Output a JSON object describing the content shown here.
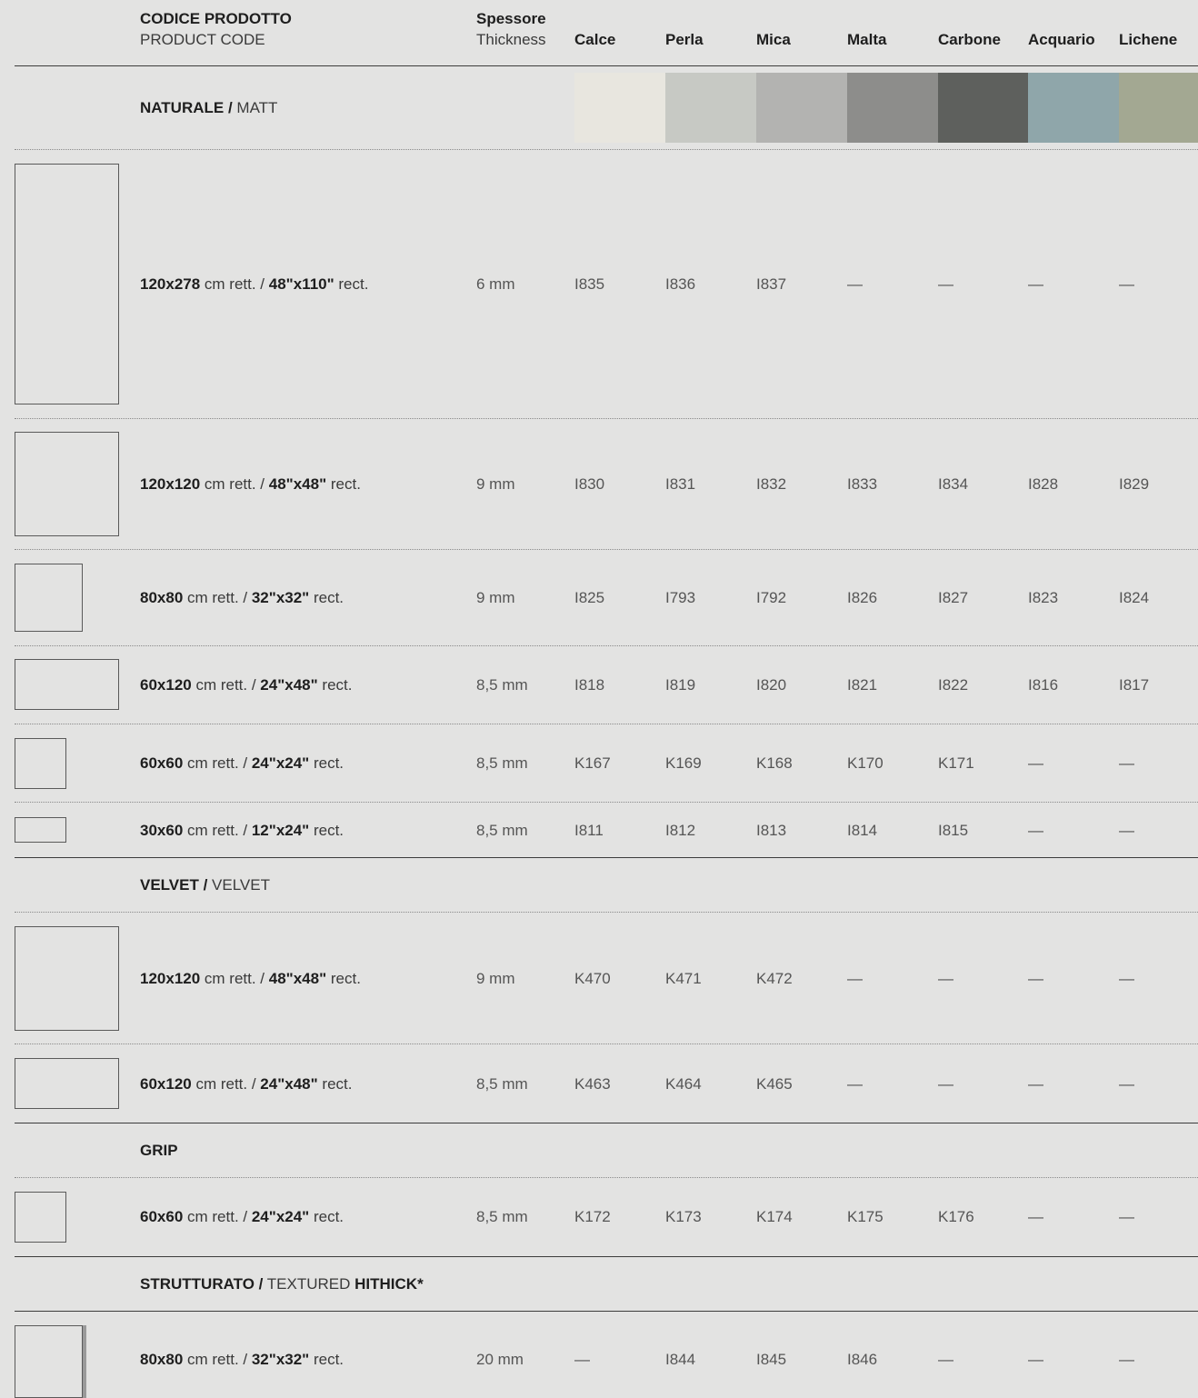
{
  "header": {
    "code_bold": "CODICE PRODOTTO",
    "code_sub": "PRODUCT CODE",
    "thick_bold": "Spessore",
    "thick_sub": "Thickness",
    "colors": [
      "Calce",
      "Perla",
      "Mica",
      "Malta",
      "Carbone",
      "Acquario",
      "Lichene"
    ]
  },
  "swatch_colors": [
    "#e8e6df",
    "#c7c9c4",
    "#b3b3b1",
    "#8d8d8b",
    "#5e605d",
    "#8fa6aa",
    "#a3a892"
  ],
  "sections": {
    "naturale": {
      "bold": "NATURALE /",
      "rest": " MATT"
    },
    "velvet": {
      "bold": "VELVET /",
      "rest": " VELVET"
    },
    "grip": {
      "bold": "GRIP",
      "rest": ""
    },
    "strutturato": {
      "bold": "STRUTTURATO /",
      "rest": " TEXTURED ",
      "bold2": "HITHICK*"
    }
  },
  "rows": [
    {
      "cm": "120x278",
      "cm_suffix": " cm rett. / ",
      "in": "48\"x110\"",
      "in_suffix": " rect.",
      "thickness": "6 mm",
      "codes": [
        "I835",
        "I836",
        "I837",
        "—",
        "—",
        "—",
        "—"
      ]
    },
    {
      "cm": "120x120",
      "cm_suffix": " cm rett. / ",
      "in": "48\"x48\"",
      "in_suffix": " rect.",
      "thickness": "9 mm",
      "codes": [
        "I830",
        "I831",
        "I832",
        "I833",
        "I834",
        "I828",
        "I829"
      ]
    },
    {
      "cm": "80x80",
      "cm_suffix": " cm rett. / ",
      "in": "32\"x32\"",
      "in_suffix": " rect.",
      "thickness": "9 mm",
      "codes": [
        "I825",
        "I793",
        "I792",
        "I826",
        "I827",
        "I823",
        "I824"
      ]
    },
    {
      "cm": "60x120",
      "cm_suffix": " cm rett. / ",
      "in": "24\"x48\"",
      "in_suffix": " rect.",
      "thickness": "8,5 mm",
      "codes": [
        "I818",
        "I819",
        "I820",
        "I821",
        "I822",
        "I816",
        "I817"
      ]
    },
    {
      "cm": "60x60",
      "cm_suffix": " cm rett. / ",
      "in": "24\"x24\"",
      "in_suffix": " rect.",
      "thickness": "8,5 mm",
      "codes": [
        "K167",
        "K169",
        "K168",
        "K170",
        "K171",
        "—",
        "—"
      ]
    },
    {
      "cm": "30x60",
      "cm_suffix": " cm rett. / ",
      "in": "12\"x24\"",
      "in_suffix": " rect.",
      "thickness": "8,5 mm",
      "codes": [
        "I811",
        "I812",
        "I813",
        "I814",
        "I815",
        "—",
        "—"
      ]
    },
    {
      "cm": "120x120",
      "cm_suffix": " cm rett. / ",
      "in": "48\"x48\"",
      "in_suffix": " rect.",
      "thickness": "9 mm",
      "codes": [
        "K470",
        "K471",
        "K472",
        "—",
        "—",
        "—",
        "—"
      ]
    },
    {
      "cm": "60x120",
      "cm_suffix": " cm rett. / ",
      "in": "24\"x48\"",
      "in_suffix": " rect.",
      "thickness": "8,5 mm",
      "codes": [
        "K463",
        "K464",
        "K465",
        "—",
        "—",
        "—",
        "—"
      ]
    },
    {
      "cm": "60x60",
      "cm_suffix": " cm rett. / ",
      "in": "24\"x24\"",
      "in_suffix": " rect.",
      "thickness": "8,5 mm",
      "codes": [
        "K172",
        "K173",
        "K174",
        "K175",
        "K176",
        "—",
        "—"
      ]
    },
    {
      "cm": "80x80",
      "cm_suffix": " cm rett. / ",
      "in": "32\"x32\"",
      "in_suffix": " rect.",
      "thickness": "20 mm",
      "codes": [
        "—",
        "I844",
        "I845",
        "I846",
        "—",
        "—",
        "—"
      ]
    }
  ]
}
